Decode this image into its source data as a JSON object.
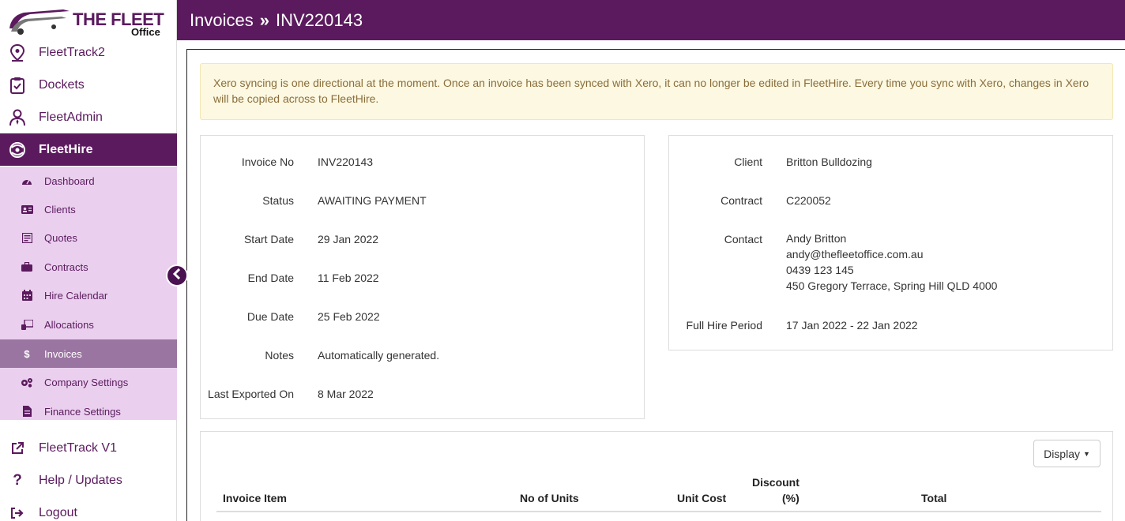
{
  "brand": {
    "line1": "THE FLEET",
    "line2": "Office"
  },
  "sidebar": {
    "main_items": [
      {
        "label": "FleetTrack2",
        "icon": "location-pin-icon"
      },
      {
        "label": "Dockets",
        "icon": "clipboard-check-icon"
      },
      {
        "label": "FleetAdmin",
        "icon": "user-tie-icon"
      },
      {
        "label": "FleetHire",
        "icon": "fleethire-icon"
      }
    ],
    "sub_items": [
      {
        "label": "Dashboard",
        "icon": "gauge-icon"
      },
      {
        "label": "Clients",
        "icon": "address-card-icon"
      },
      {
        "label": "Quotes",
        "icon": "quote-document-icon"
      },
      {
        "label": "Contracts",
        "icon": "briefcase-icon"
      },
      {
        "label": "Hire Calendar",
        "icon": "calendar-icon"
      },
      {
        "label": "Allocations",
        "icon": "allocations-icon"
      },
      {
        "label": "Invoices",
        "icon": "dollar-icon"
      },
      {
        "label": "Company Settings",
        "icon": "cogs-icon"
      },
      {
        "label": "Finance Settings",
        "icon": "file-invoice-icon"
      }
    ],
    "bottom_items": [
      {
        "label": "FleetTrack V1",
        "icon": "external-link-icon"
      },
      {
        "label": "Help / Updates",
        "icon": "question-icon"
      },
      {
        "label": "Logout",
        "icon": "sign-out-icon"
      }
    ],
    "active_main": "FleetHire",
    "active_sub": "Invoices"
  },
  "header": {
    "section": "Invoices",
    "separator": "»",
    "record": "INV220143"
  },
  "alert": {
    "text": "Xero syncing is one directional at the moment. Once an invoice has been synced with Xero, it can no longer be edited in FleetHire. Every time you sync with Xero, changes in Xero will be copied across to FleetHire."
  },
  "invoice": {
    "invoice_no_label": "Invoice No",
    "invoice_no": "INV220143",
    "status_label": "Status",
    "status": "AWAITING PAYMENT",
    "start_date_label": "Start Date",
    "start_date": "29 Jan 2022",
    "end_date_label": "End Date",
    "end_date": "11 Feb 2022",
    "due_date_label": "Due Date",
    "due_date": "25 Feb 2022",
    "notes_label": "Notes",
    "notes": "Automatically generated.",
    "last_exported_label": "Last Exported On",
    "last_exported": "8 Mar 2022"
  },
  "client_panel": {
    "client_label": "Client",
    "client": "Britton Bulldozing",
    "contract_label": "Contract",
    "contract": "C220052",
    "contact_label": "Contact",
    "contact_name": "Andy Britton",
    "contact_email": "andy@thefleetoffice.com.au",
    "contact_phone": "0439 123 145",
    "contact_address": "450 Gregory Terrace, Spring Hill QLD 4000",
    "hire_period_label": "Full Hire Period",
    "hire_period": "17 Jan 2022 - 22 Jan 2022"
  },
  "items_table": {
    "display_button": "Display",
    "headers": {
      "item": "Invoice Item",
      "units": "No of Units",
      "unit_cost": "Unit Cost",
      "discount_line1": "Discount",
      "discount_line2": "(%)",
      "total": "Total"
    }
  },
  "colors": {
    "brand": "#5b1a5e",
    "subnav_bg": "#ead0ee",
    "sub_active": "#9b75a1",
    "alert_bg": "#fcf8e1",
    "alert_text": "#8a6d3b"
  }
}
